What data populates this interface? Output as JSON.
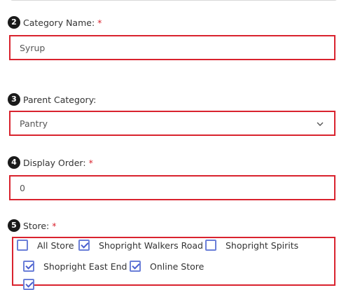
{
  "category_name": {
    "step": "2",
    "label": "Category Name:",
    "required": "*",
    "value": "Syrup"
  },
  "parent_category": {
    "step": "3",
    "label": "Parent Category:",
    "value": "Pantry",
    "icon": "chevron-down-icon"
  },
  "display_order": {
    "step": "4",
    "label": "Display Order:",
    "required": "*",
    "value": "0"
  },
  "store": {
    "step": "5",
    "label": "Store:",
    "required": "*",
    "options": [
      {
        "label": "All Store",
        "checked": false
      },
      {
        "label": "Shopright Walkers Road",
        "checked": true
      },
      {
        "label": "Shopright Spirits",
        "checked": false
      },
      {
        "label": "Shopright East End",
        "checked": true
      },
      {
        "label": "Online Store",
        "checked": true
      }
    ]
  },
  "colors": {
    "highlight": "#d9232e",
    "checkbox": "#4a5fcf"
  }
}
